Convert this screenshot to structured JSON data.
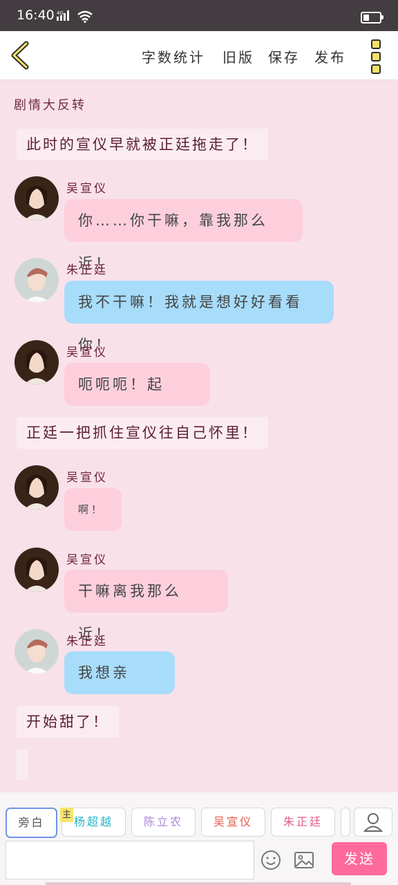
{
  "status": {
    "time": "16:40",
    "signal_label": "4G"
  },
  "toolbar": {
    "word_count": "字数统计",
    "old_version": "旧版",
    "save": "保存",
    "publish": "发布",
    "back_icon": "chevron-left-icon",
    "more_icon": "more-vertical-icon"
  },
  "scene_title": "剧情大反转",
  "messages": [
    {
      "type": "narration",
      "text": "此时的宣仪早就被正廷拖走了！"
    },
    {
      "type": "left",
      "speaker": "吴宣仪",
      "text": "你……你干嘛，靠我那么近！",
      "bubble_color": "#fdcfdc"
    },
    {
      "type": "left",
      "speaker": "朱正廷",
      "text": "我不干嘛！我就是想好好看看你！",
      "bubble_color": "#a7dcfa"
    },
    {
      "type": "left",
      "speaker": "吴宣仪",
      "text": "呃呃呃！起开！",
      "bubble_color": "#fdcfdc"
    },
    {
      "type": "narration",
      "text": "正廷一把抓住宣仪往自己怀里！"
    },
    {
      "type": "left",
      "speaker": "吴宣仪",
      "text": "啊！",
      "bubble_color": "#fdcfdc"
    },
    {
      "type": "left",
      "speaker": "吴宣仪",
      "text": "干嘛离我那么近！",
      "bubble_color": "#fdcfdc"
    },
    {
      "type": "left",
      "speaker": "朱正廷",
      "text": "我想亲你！",
      "bubble_color": "#a7dcfa"
    },
    {
      "type": "narration",
      "text": "开始甜了！"
    }
  ],
  "roles": [
    {
      "label": "旁白",
      "color": "#555555",
      "selected": true
    },
    {
      "label": "杨超越",
      "color": "#26b3c8",
      "badge": "主"
    },
    {
      "label": "陈立农",
      "color": "#a987d8"
    },
    {
      "label": "吴宣仪",
      "color": "#e05a4a"
    },
    {
      "label": "朱正廷",
      "color": "#e0588a"
    }
  ],
  "composer": {
    "input_value": "",
    "send_label": "发送",
    "emoji_icon": "smiley-icon",
    "image_icon": "image-icon",
    "person_icon": "user-icon"
  },
  "colors": {
    "accent": "#ff6a9c",
    "background": "#f9e1ea",
    "speaker_name": "#6b1f35"
  }
}
